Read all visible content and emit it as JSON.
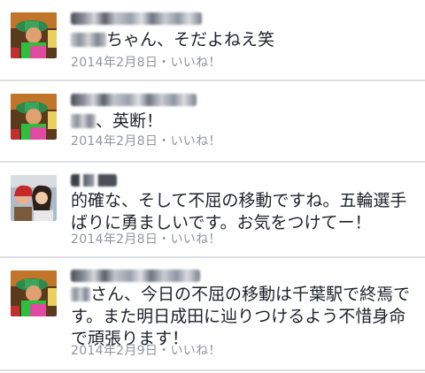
{
  "comments": [
    {
      "text": "ちゃん、そだよねえ笑",
      "date": "2014年2月8日",
      "separator": "・",
      "like_label": "いいね！",
      "avatar_icon": "profile-photo-colorful"
    },
    {
      "text": "、英断！",
      "date": "2014年2月8日",
      "separator": "・",
      "like_label": "いいね！",
      "avatar_icon": "profile-photo-colorful"
    },
    {
      "text": "的確な、そして不屈の移動ですね。五輪選手ばりに勇ましいです。お気をつけてー！",
      "date": "2014年2月8日",
      "separator": "・",
      "like_label": "いいね！",
      "avatar_icon": "profile-photo-women"
    },
    {
      "text": "さん、今日の不屈の移動は千葉駅で終焉です。また明日成田に辿りつけるよう不惜身命で頑張ります！",
      "date": "2014年2月9日",
      "separator": "・",
      "like_label": "いいね！",
      "avatar_icon": "profile-photo-colorful"
    }
  ],
  "colors": {
    "text": "#1d2129",
    "meta": "#90949c",
    "divider": "#dddfe2"
  }
}
